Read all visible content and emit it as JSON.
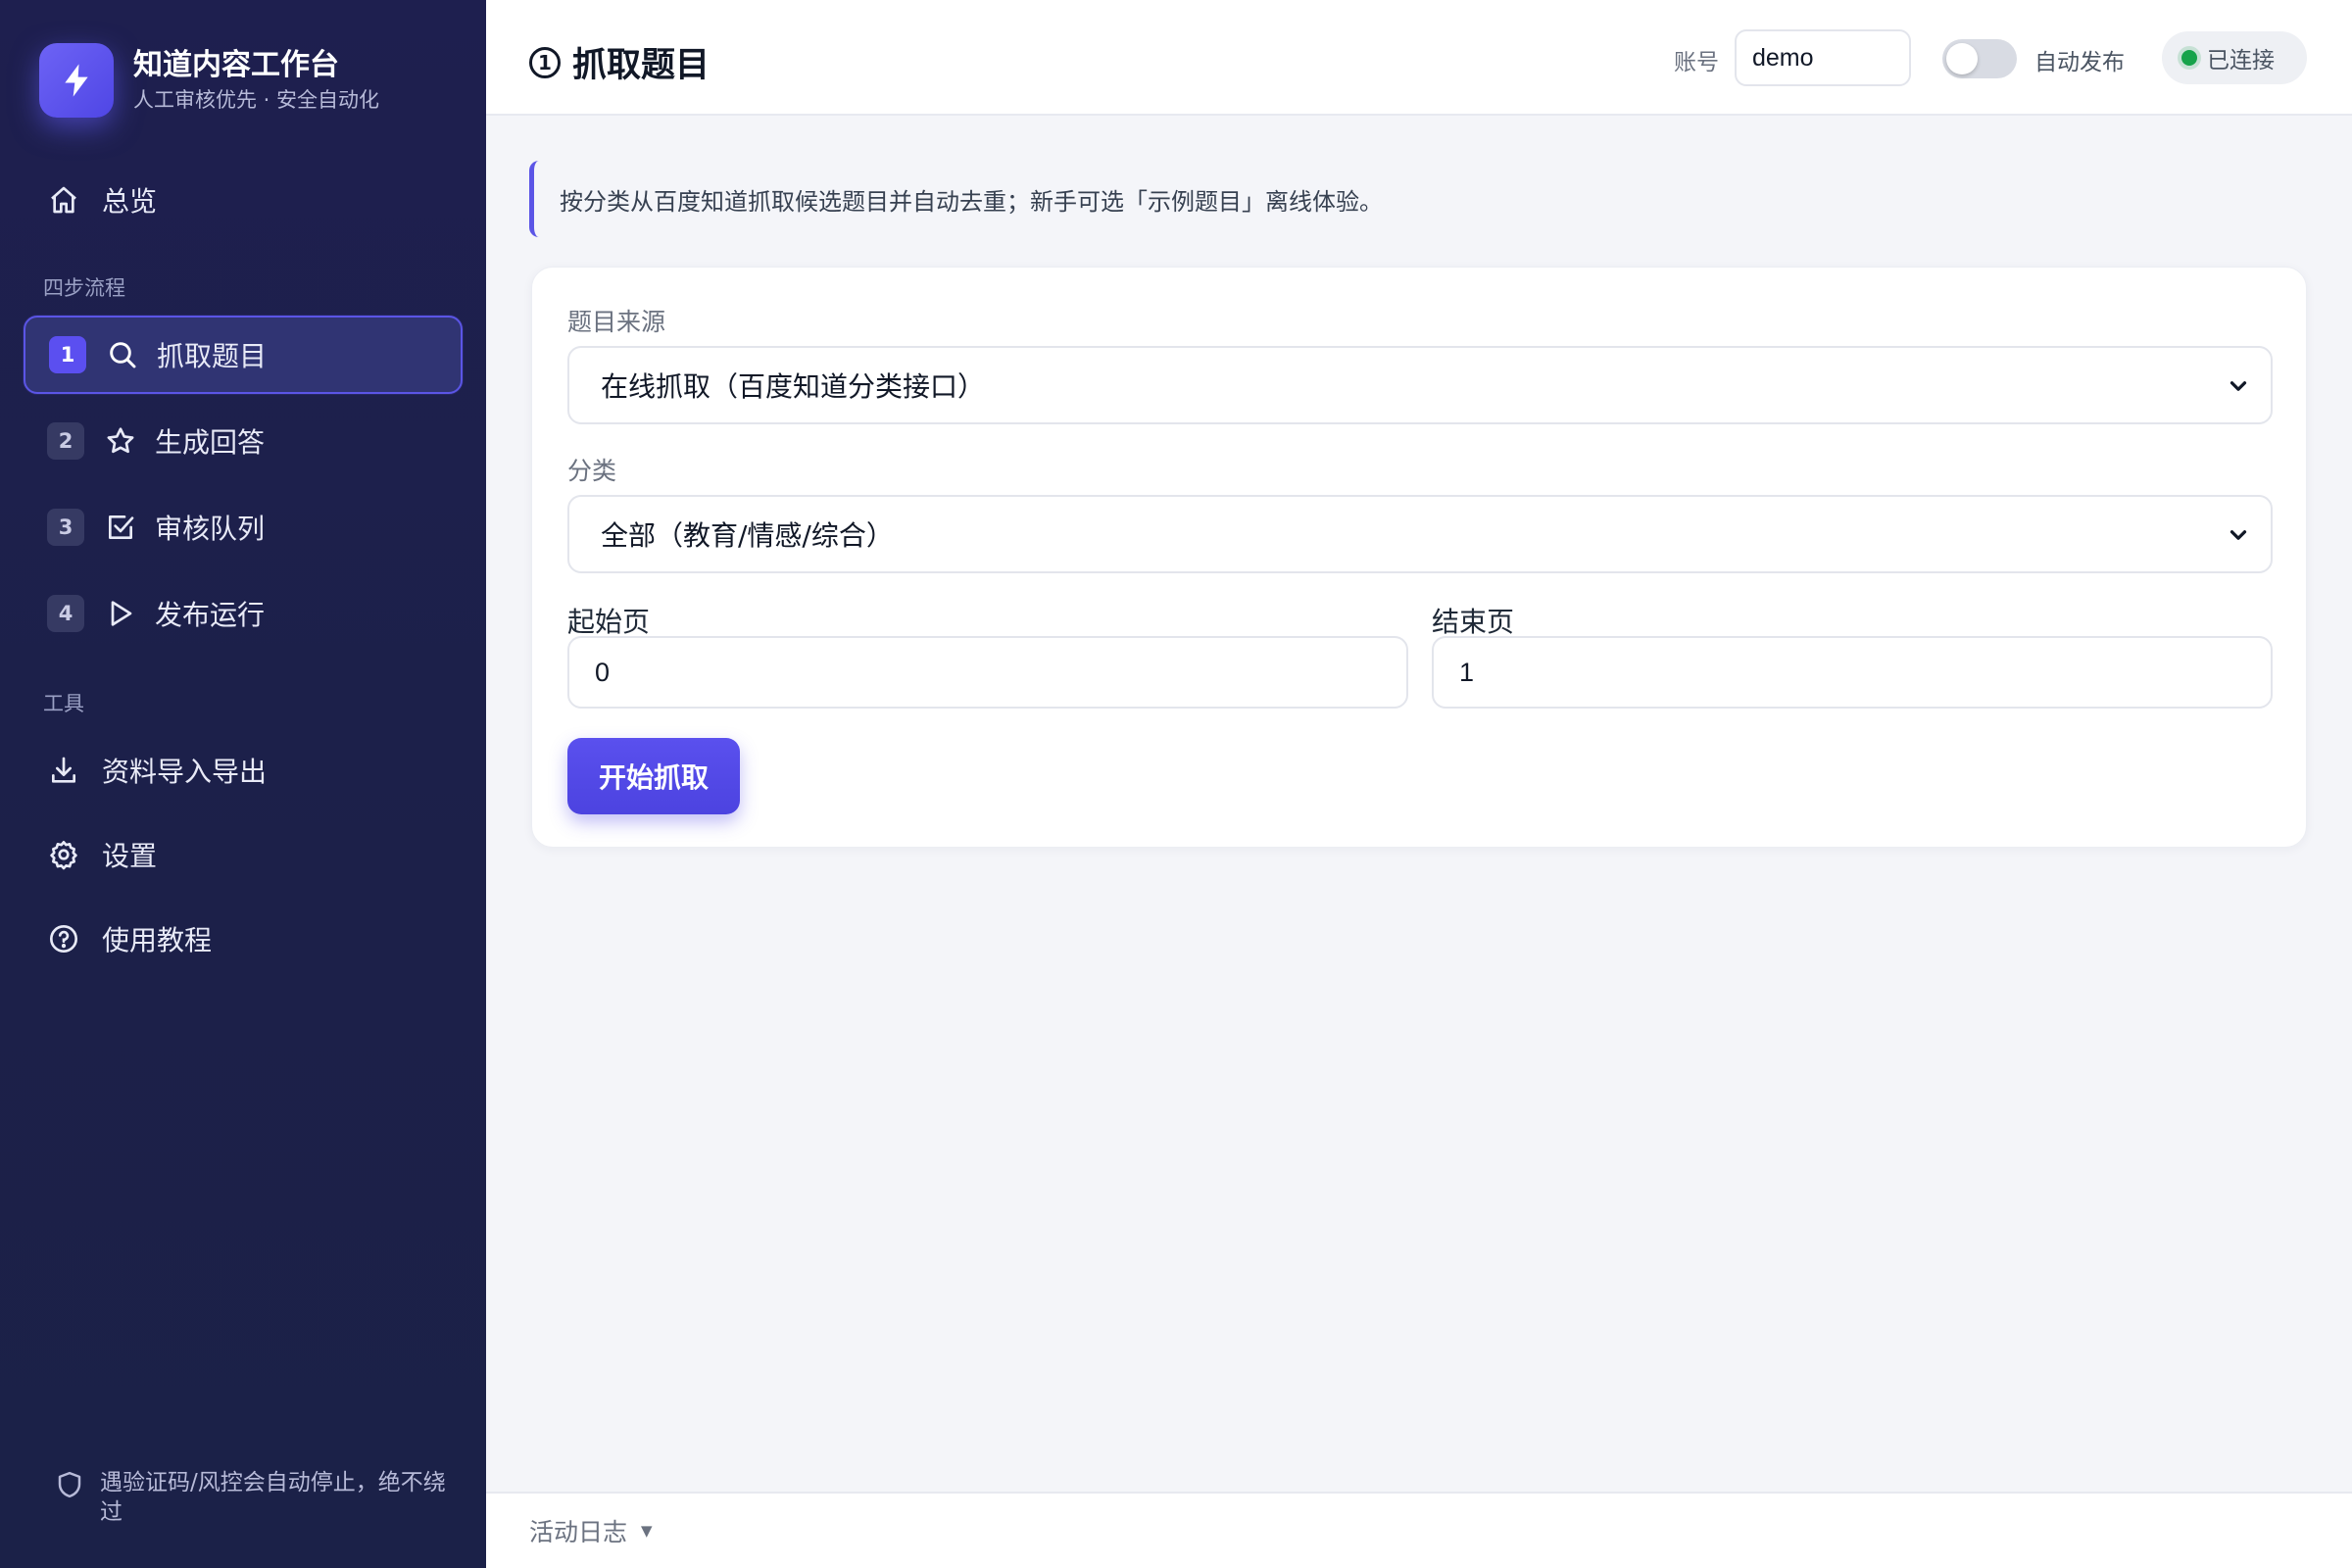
{
  "brand": {
    "title": "知道内容工作台",
    "subtitle": "人工审核优先 · 安全自动化",
    "logo_icon": "lightning-bolt-icon"
  },
  "sidebar": {
    "overview": {
      "label": "总览",
      "icon": "home-icon"
    },
    "steps_section_label": "四步流程",
    "steps": [
      {
        "num": "1",
        "label": "抓取题目",
        "icon": "search-icon",
        "active": true
      },
      {
        "num": "2",
        "label": "生成回答",
        "icon": "star-icon",
        "active": false
      },
      {
        "num": "3",
        "label": "审核队列",
        "icon": "checkbox-icon",
        "active": false
      },
      {
        "num": "4",
        "label": "发布运行",
        "icon": "play-icon",
        "active": false
      }
    ],
    "tools_section_label": "工具",
    "tools": [
      {
        "label": "资料导入导出",
        "icon": "download-icon"
      },
      {
        "label": "设置",
        "icon": "gear-icon"
      },
      {
        "label": "使用教程",
        "icon": "help-circle-icon"
      }
    ],
    "footer_note": "遇验证码/风控会自动停止，绝不绕过"
  },
  "topbar": {
    "title_num": "1",
    "title": "抓取题目",
    "account_label": "账号",
    "account_value": "demo",
    "auto_publish_label": "自动发布",
    "auto_publish_on": false,
    "status_label": "已连接",
    "status_color": "#16a34a"
  },
  "main": {
    "notice": "按分类从百度知道抓取候选题目并自动去重；新手可选「示例题目」离线体验。",
    "source": {
      "label": "题目来源",
      "selected": "在线抓取（百度知道分类接口）"
    },
    "category": {
      "label": "分类",
      "selected": "全部（教育/情感/综合）"
    },
    "start_page": {
      "label": "起始页",
      "value": "0"
    },
    "end_page": {
      "label": "结束页",
      "value": "1"
    },
    "submit_label": "开始抓取"
  },
  "logbar": {
    "label": "活动日志"
  },
  "colors": {
    "accent": "#4f46e5",
    "sidebar_bg": "#1c2049",
    "page_bg": "#f4f5f9"
  }
}
